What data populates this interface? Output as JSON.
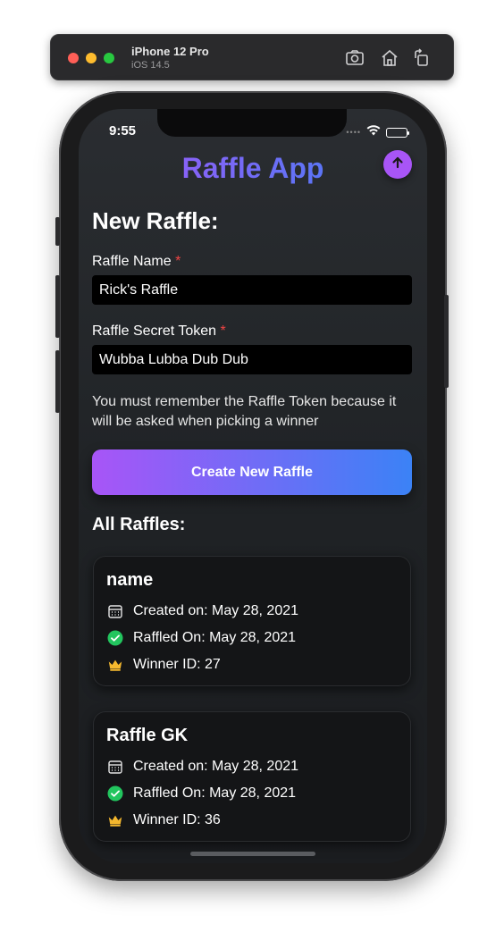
{
  "simulator": {
    "device_name": "iPhone 12 Pro",
    "os_version": "iOS 14.5",
    "icons": [
      "screenshot-icon",
      "home-icon",
      "rotate-icon"
    ]
  },
  "status_bar": {
    "time": "9:55",
    "signal_dots": "••••"
  },
  "app": {
    "title": "Raffle App",
    "upload_icon": "arrow-up-icon"
  },
  "new_raffle": {
    "heading": "New Raffle:",
    "name_label": "Raffle Name",
    "name_required": "*",
    "name_value": "Rick's Raffle",
    "token_label": "Raffle Secret Token",
    "token_required": "*",
    "token_value": "Wubba Lubba Dub Dub",
    "hint": "You must remember the Raffle Token because it will be asked when picking a winner",
    "create_button": "Create New Raffle"
  },
  "all_raffles": {
    "heading": "All Raffles:",
    "items": [
      {
        "name": "name",
        "created": "Created on: May 28, 2021",
        "raffled": "Raffled On: May 28, 2021",
        "winner": "Winner ID: 27"
      },
      {
        "name": "Raffle GK",
        "created": "Created on: May 28, 2021",
        "raffled": "Raffled On: May 28, 2021",
        "winner": "Winner ID: 36"
      }
    ]
  },
  "colors": {
    "accent_purple": "#a855f7",
    "accent_blue": "#3b82f6",
    "required_red": "#ef4444",
    "check_green": "#22c55e",
    "crown_gold": "#f5b82e"
  }
}
